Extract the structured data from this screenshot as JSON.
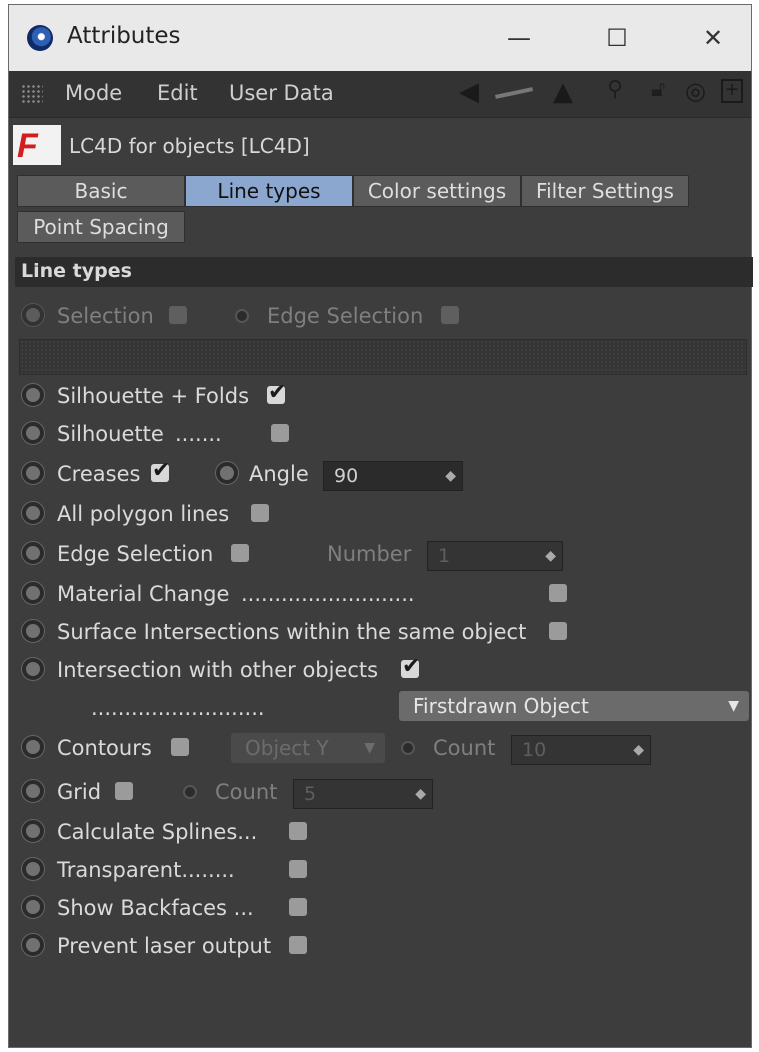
{
  "window": {
    "title": "Attributes",
    "minimize": "—",
    "maximize": "☐",
    "close": "✕"
  },
  "menubar": {
    "items": [
      "Mode",
      "Edit",
      "User Data"
    ]
  },
  "object": {
    "name": "LC4D for objects [LC4D]",
    "logo_letter": "F"
  },
  "tabs": [
    "Basic",
    "Line types",
    "Color settings",
    "Filter Settings",
    "Point Spacing"
  ],
  "active_tab": "Line types",
  "section": {
    "title": "Line types"
  },
  "rows": {
    "selection": "Selection",
    "edge_selection_top": "Edge Selection",
    "silhouette_folds": "Silhouette + Folds",
    "silhouette": "Silhouette",
    "silhouette_dots": ".......",
    "creases": "Creases",
    "angle": "Angle",
    "angle_value": "90",
    "all_polygon": "All polygon lines",
    "edge_selection": "Edge Selection",
    "number": "Number",
    "number_value": "1",
    "material_change": "Material Change",
    "material_dots": "..........................",
    "surface_intersections": "Surface Intersections within the same object",
    "intersection_other": "Intersection with other objects",
    "first_dots": "..........................",
    "firstdrawn": "Firstdrawn Object",
    "contours": "Contours",
    "object_y": "Object Y",
    "count": "Count",
    "count_contours": "10",
    "grid": "Grid",
    "count_grid": "5",
    "calc_splines": "Calculate Splines...",
    "transparent": "Transparent........",
    "show_backfaces": "Show Backfaces ...",
    "prevent_laser": "Prevent laser output"
  },
  "checked": {
    "silhouette_folds": true,
    "creases": true,
    "intersection_other": true
  }
}
